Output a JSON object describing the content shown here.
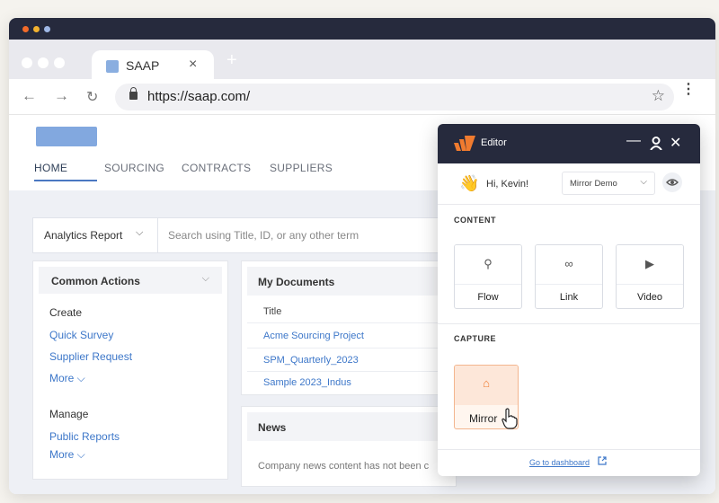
{
  "browser": {
    "tab_title": "SAAP",
    "close_glyph": "×",
    "newtab_glyph": "+",
    "url": "https://saap.com/",
    "icons": {
      "back": "←",
      "forward": "→",
      "reload": "↻",
      "star": "☆",
      "menu": "⋮"
    }
  },
  "app": {
    "nav": [
      "HOME",
      "SOURCING",
      "CONTRACTS",
      "SUPPLIERS"
    ],
    "search": {
      "report_selector": "Analytics Report",
      "chevron": "⌵",
      "placeholder": "Search using Title, ID, or any other term"
    },
    "common_actions": {
      "title": "Common Actions",
      "create_label": "Create",
      "create_links": [
        "Quick Survey",
        "Supplier Request",
        "More ⌵"
      ],
      "manage_label": "Manage",
      "manage_links": [
        "Public Reports",
        "More ⌵"
      ]
    },
    "documents": {
      "title": "My Documents",
      "column_title": "Title",
      "rows": [
        "Acme Sourcing Project",
        "SPM_Quarterly_2023",
        "Sample 2023_Indus"
      ]
    },
    "news": {
      "title": "News",
      "text": "Company news content has not been c"
    }
  },
  "editor": {
    "title": "Editor",
    "controls": {
      "minimize": "—",
      "close": "✕"
    },
    "greeting": "Hi, Kevin!",
    "wave_emoji": "👋",
    "demo_select": "Mirror Demo",
    "content_label": "CONTENT",
    "tiles": [
      {
        "label": "Flow",
        "icon": "⚲"
      },
      {
        "label": "Link",
        "icon": "∞"
      },
      {
        "label": "Video",
        "icon": "▶"
      }
    ],
    "capture_label": "CAPTURE",
    "capture_tile": {
      "label": "Mirror",
      "icon": "⌂"
    },
    "dashboard_link": "Go to dashboard",
    "accent": "#f07b2f"
  }
}
